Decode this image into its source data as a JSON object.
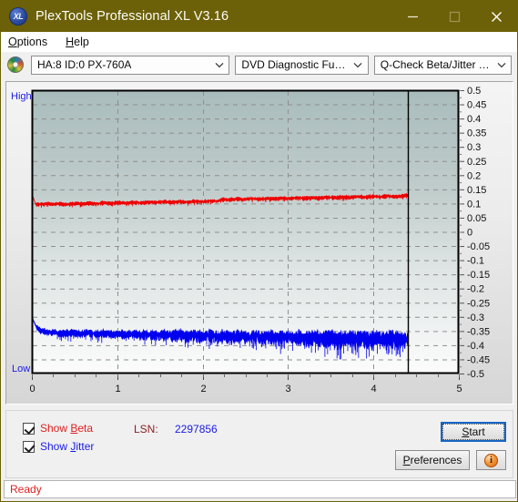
{
  "window": {
    "title": "PlexTools Professional XL V3.16",
    "icon": "XL",
    "icon_name": "app-logo-icon",
    "minimize_label": "Minimize",
    "maximize_label": "Maximize",
    "close_label": "Close",
    "titlebar_color": "#6c6008"
  },
  "menu": {
    "items": [
      {
        "label": "Options",
        "mnemonic": "O"
      },
      {
        "label": "Help",
        "mnemonic": "H"
      }
    ]
  },
  "toolbar": {
    "drive_icon": "optical-disc-icon",
    "drive_select": "HA:8 ID:0  PX-760A",
    "function_select": "DVD Diagnostic Functions",
    "test_select": "Q-Check Beta/Jitter Test"
  },
  "chart_data": {
    "type": "line",
    "title": "Q-Check Beta/Jitter Test",
    "xlabel": "",
    "ylabel": "",
    "xlim": [
      0,
      5
    ],
    "ylim": [
      -0.5,
      0.5
    ],
    "xticks": [
      0,
      1,
      2,
      3,
      4,
      5
    ],
    "xticklabels": [
      "0",
      "1",
      "2",
      "3",
      "4",
      "5"
    ],
    "yticks": [
      0.5,
      0.45,
      0.4,
      0.35,
      0.3,
      0.25,
      0.2,
      0.15,
      0.1,
      0.05,
      0,
      -0.05,
      -0.1,
      -0.15,
      -0.2,
      -0.25,
      -0.3,
      -0.35,
      -0.4,
      -0.45,
      -0.5
    ],
    "yticklabels": [
      "0.5",
      "0.45",
      "0.4",
      "0.35",
      "0.3",
      "0.25",
      "0.2",
      "0.15",
      "0.1",
      "0.05",
      "0",
      "-0.05",
      "-0.1",
      "-0.15",
      "-0.2",
      "-0.25",
      "-0.3",
      "-0.35",
      "-0.4",
      "-0.45",
      "-0.5"
    ],
    "axis_top_label": "High",
    "axis_bottom_label": "Low",
    "grid": true,
    "grid_style": "dashed",
    "data_end_x": 4.4,
    "series": [
      {
        "name": "Beta",
        "color": "#ee0000",
        "x_start": 0.0,
        "x_end": 4.4,
        "mean": 0.105,
        "noise": 0.01,
        "values": [
          0.135,
          0.098,
          0.097,
          0.099,
          0.1,
          0.098,
          0.099,
          0.101,
          0.098,
          0.097,
          0.099,
          0.1,
          0.101,
          0.099,
          0.1,
          0.102,
          0.101,
          0.1,
          0.102,
          0.103,
          0.102,
          0.101,
          0.103,
          0.104,
          0.103,
          0.102,
          0.104,
          0.105,
          0.104,
          0.103,
          0.105,
          0.106,
          0.105,
          0.104,
          0.106,
          0.107,
          0.106,
          0.105,
          0.107,
          0.108,
          0.107,
          0.106,
          0.108,
          0.109,
          0.108,
          0.107,
          0.109,
          0.11,
          0.109,
          0.108,
          0.116,
          0.115,
          0.114,
          0.116,
          0.117,
          0.116,
          0.115,
          0.117,
          0.118,
          0.117,
          0.116,
          0.118,
          0.119,
          0.118,
          0.117,
          0.119,
          0.12,
          0.119,
          0.118,
          0.12,
          0.121,
          0.12,
          0.119,
          0.121,
          0.122,
          0.121,
          0.12,
          0.122,
          0.123,
          0.122,
          0.121,
          0.123,
          0.124,
          0.123,
          0.122,
          0.124,
          0.125,
          0.124,
          0.123,
          0.125,
          0.126,
          0.125,
          0.124,
          0.126,
          0.127,
          0.126,
          0.125,
          0.127,
          0.128,
          0.13
        ]
      },
      {
        "name": "Jitter",
        "color": "#0000ee",
        "x_start": 0.0,
        "x_end": 4.4,
        "mean": -0.355,
        "noise": 0.035,
        "values": [
          -0.3,
          -0.33,
          -0.345,
          -0.35,
          -0.352,
          -0.355,
          -0.353,
          -0.356,
          -0.358,
          -0.355,
          -0.356,
          -0.354,
          -0.357,
          -0.359,
          -0.356,
          -0.355,
          -0.358,
          -0.36,
          -0.357,
          -0.356,
          -0.359,
          -0.361,
          -0.358,
          -0.357,
          -0.36,
          -0.362,
          -0.359,
          -0.358,
          -0.361,
          -0.363,
          -0.36,
          -0.359,
          -0.362,
          -0.364,
          -0.361,
          -0.36,
          -0.363,
          -0.365,
          -0.362,
          -0.361,
          -0.364,
          -0.366,
          -0.363,
          -0.362,
          -0.365,
          -0.367,
          -0.364,
          -0.363,
          -0.366,
          -0.368,
          -0.365,
          -0.364,
          -0.367,
          -0.369,
          -0.366,
          -0.365,
          -0.368,
          -0.37,
          -0.367,
          -0.366,
          -0.369,
          -0.371,
          -0.368,
          -0.367,
          -0.37,
          -0.372,
          -0.369,
          -0.368,
          -0.371,
          -0.373,
          -0.37,
          -0.369,
          -0.372,
          -0.374,
          -0.371,
          -0.37,
          -0.373,
          -0.375,
          -0.372,
          -0.371,
          -0.374,
          -0.376,
          -0.373,
          -0.372,
          -0.375,
          -0.377,
          -0.374,
          -0.373,
          -0.376,
          -0.378,
          -0.375,
          -0.374,
          -0.377,
          -0.379,
          -0.376,
          -0.375,
          -0.378,
          -0.38,
          -0.377,
          -0.376
        ]
      }
    ]
  },
  "controls": {
    "show_beta": {
      "label_pre": "Show ",
      "label_mnemonic": "B",
      "label_post": "eta",
      "checked": true
    },
    "show_jitter": {
      "label_pre": "Show ",
      "label_mnemonic": "J",
      "label_post": "itter",
      "checked": true
    },
    "lsn_label": "LSN:",
    "lsn_value": "2297856",
    "start_button": {
      "pre": "",
      "mnemonic": "S",
      "post": "tart"
    },
    "preferences_button": {
      "pre": "",
      "mnemonic": "P",
      "post": "references"
    },
    "info_button": {
      "icon": "info-icon",
      "glyph": "i"
    }
  },
  "status": {
    "text": "Ready",
    "color": "#e02020"
  }
}
